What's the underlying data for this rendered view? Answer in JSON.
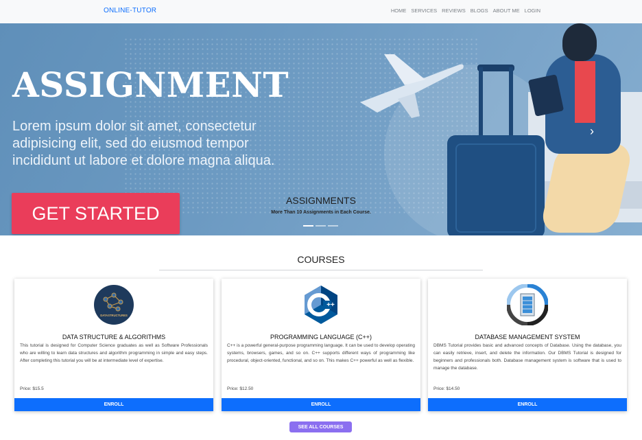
{
  "navbar": {
    "brand": "ONLINE-TUTOR",
    "links": [
      "HOME",
      "SERVICES",
      "REVIEWS",
      "BLOGS",
      "ABOUT ME",
      "LOGIN"
    ]
  },
  "hero": {
    "title": "ASSIGNMENT",
    "lorem": "Lorem ipsum dolor sit amet, consectetur adipisicing elit, sed do eiusmod tempor incididunt ut labore et dolore magna aliqua.",
    "cta": "GET STARTED",
    "caption_title": "ASSIGNMENTS",
    "caption_subtitle": "More Than 10 Assignments in Each Course.",
    "slides": 3,
    "active_slide": 1
  },
  "courses": {
    "heading": "COURSES",
    "items": [
      {
        "title": "DATA STRUCTURE & ALGORITHMS",
        "logo_text": "DATASTRUCTURES",
        "description": "This tutorial is designed for Computer Science graduates as well as Software Professionals who are willing to learn data structures and algorithm programming in simple and easy steps. After completing this tutorial you will be at intermediate level of expertise.",
        "price": "Price: $15.5",
        "enroll": "ENROLL"
      },
      {
        "title": "PROGRAMMING LANGUAGE (C++)",
        "logo_text": "C++",
        "description": "C++ is a powerful general-purpose programming language. It can be used to develop operating systems, browsers, games, and so on. C++ supports different ways of programming like procedural, object-oriented, functional, and so on. This makes C++ powerful as well as flexible.",
        "price": "Price: $12.50",
        "enroll": "ENROLL"
      },
      {
        "title": "DATABASE MANAGEMENT SYSTEM",
        "logo_text": "",
        "description": "DBMS Tutorial provides basic and advanced concepts of Database. Using the database, you can easily retrieve, insert, and delete the information. Our DBMS Tutorial is designed for beginners and professionals both. Database management system is software that is used to manage the database.",
        "price": "Price: $14.50",
        "enroll": "ENROLL"
      }
    ],
    "see_all": "SEE ALL COURSES"
  },
  "colors": {
    "brand": "#0d6efd",
    "enroll": "#0d6efd",
    "cta": "#ea3d5a",
    "see_all": "#8b6ff0",
    "hero_bg": "#6c9ac2"
  }
}
